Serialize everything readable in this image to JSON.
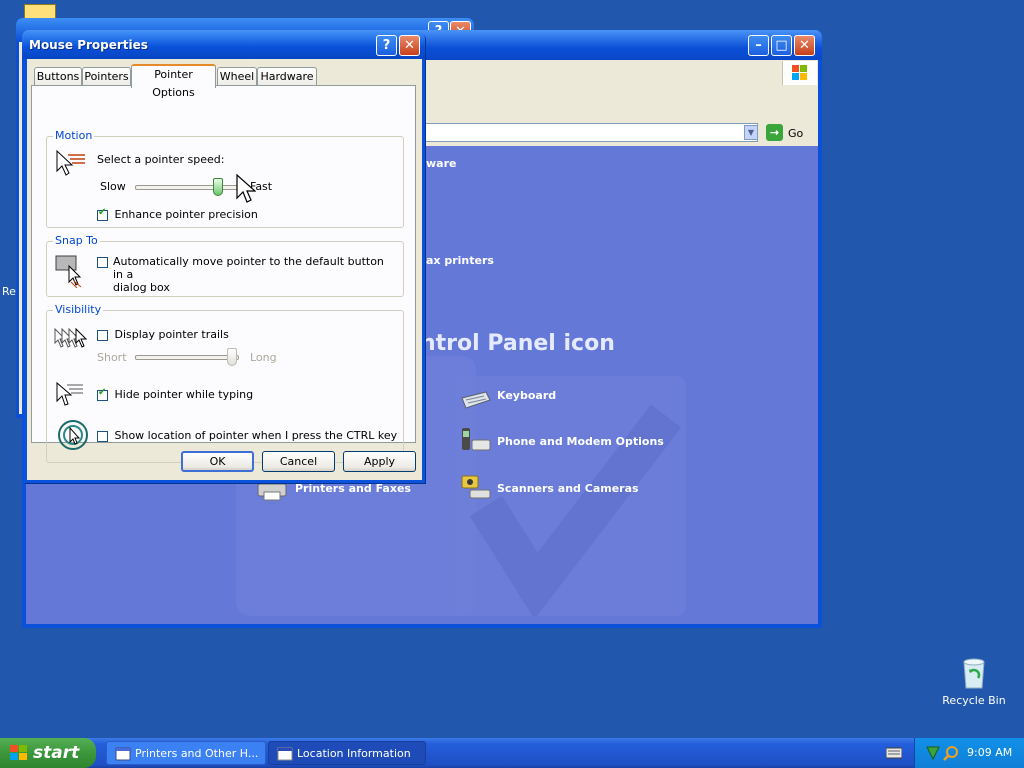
{
  "colors": {
    "desktop": "#2157ad",
    "xp_blue": "#0a52db",
    "dialog_face": "#ece9d8",
    "cp_content": "#6478d8",
    "group_label": "#0046d5"
  },
  "desktop": {
    "recycle_bin_label": "Recycle Bin",
    "clipped_left_text": "Re"
  },
  "background_window": {
    "title_fragment": "Location Information"
  },
  "control_panel": {
    "address_go_label": "Go",
    "partial_items": [
      "ware",
      "ax printers"
    ],
    "heading_fragment": "ntrol Panel icon",
    "items": [
      {
        "label": "Keyboard",
        "icon": "keyboard-icon"
      },
      {
        "label": "Phone and Modem Options",
        "icon": "phone-icon"
      },
      {
        "label": "Printers and Faxes",
        "icon": "printer-icon"
      },
      {
        "label": "Scanners and Cameras",
        "icon": "scanner-icon"
      }
    ]
  },
  "dialog": {
    "title": "Mouse Properties",
    "help_glyph": "?",
    "close_glyph": "✕",
    "tabs": [
      "Buttons",
      "Pointers",
      "Pointer Options",
      "Wheel",
      "Hardware"
    ],
    "active_tab": "Pointer Options",
    "motion": {
      "group_label": "Motion",
      "speed_label": "Select a pointer speed:",
      "slow_label": "Slow",
      "fast_label": "Fast",
      "speed_level": 0.85,
      "precision_label": "Enhance pointer precision",
      "precision_checked": true
    },
    "snap_to": {
      "group_label": "Snap To",
      "line1": "Automatically move pointer to the default button in a",
      "line2": "dialog box",
      "checked": false
    },
    "visibility": {
      "group_label": "Visibility",
      "trails_label": "Display pointer trails",
      "trails_checked": false,
      "short_label": "Short",
      "long_label": "Long",
      "trail_level": 1.0,
      "hide_label": "Hide pointer while typing",
      "hide_checked": true,
      "ctrl_label": "Show location of pointer when I press the CTRL key",
      "ctrl_checked": false
    },
    "buttons": {
      "ok": "OK",
      "cancel": "Cancel",
      "apply": "Apply"
    }
  },
  "taskbar": {
    "start_label": "start",
    "tasks": [
      {
        "label": "Printers and Other H...",
        "active": true
      },
      {
        "label": "Location Information",
        "active": false
      }
    ],
    "clock": "9:09 AM"
  }
}
